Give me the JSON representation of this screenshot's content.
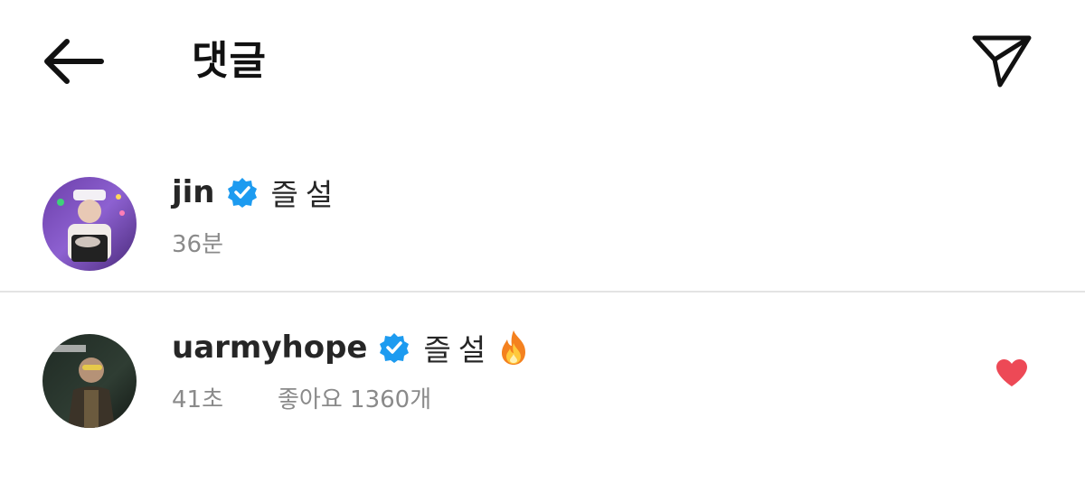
{
  "header": {
    "title": "댓글",
    "back_icon": "arrow-left-icon",
    "share_icon": "paper-plane-icon"
  },
  "comments": [
    {
      "username": "jin",
      "verified": true,
      "text": "즐설",
      "time": "36분",
      "liked": false
    },
    {
      "username": "uarmyhope",
      "verified": true,
      "text": "즐설",
      "emoji": "fire-emoji",
      "time": "41초",
      "likes": "좋아요 1360개",
      "liked": true
    }
  ],
  "colors": {
    "verified_blue": "#1d9bf0",
    "heart_red": "#ed4956",
    "meta_gray": "#8a8a8a",
    "divider": "#e3e3e3"
  }
}
